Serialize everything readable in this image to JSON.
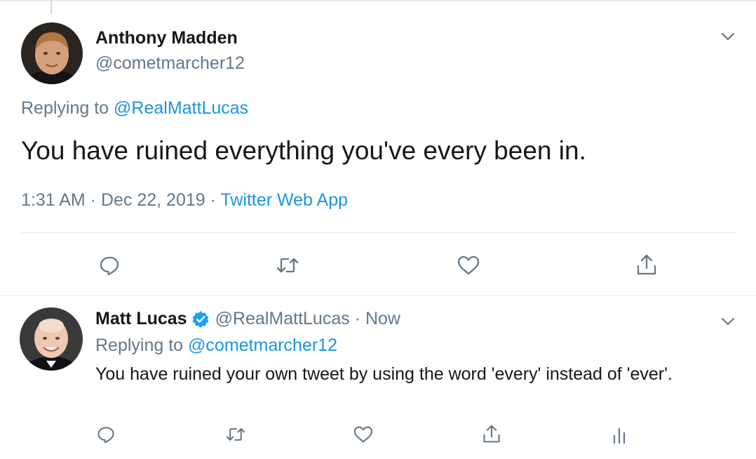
{
  "main_tweet": {
    "author_name": "Anthony Madden",
    "author_handle": "@cometmarcher12",
    "replying_prefix": "Replying to ",
    "replying_to": "@RealMattLucas",
    "text": "You have ruined everything you've every been in.",
    "time": "1:31 AM",
    "separator": " · ",
    "date": "Dec 22, 2019",
    "source": "Twitter Web App",
    "icons": [
      "chevron-down-icon",
      "reply-icon",
      "retweet-icon",
      "like-icon",
      "share-icon"
    ]
  },
  "reply_tweet": {
    "author_name": "Matt Lucas",
    "author_handle": "@RealMattLucas",
    "separator": " · ",
    "time": "Now",
    "replying_prefix": "Replying to ",
    "replying_to": "@cometmarcher12",
    "text": "You have ruined your own tweet by using the word 'every' instead of 'ever'.",
    "icons": [
      "verified-badge-icon",
      "chevron-down-icon",
      "reply-icon",
      "retweet-icon",
      "like-icon",
      "share-icon",
      "analytics-icon"
    ]
  },
  "colors": {
    "text": "#14171a",
    "secondary": "#657786",
    "link": "#1b95e0",
    "divider": "#e6ecf0",
    "verified": "#1da1f2"
  }
}
